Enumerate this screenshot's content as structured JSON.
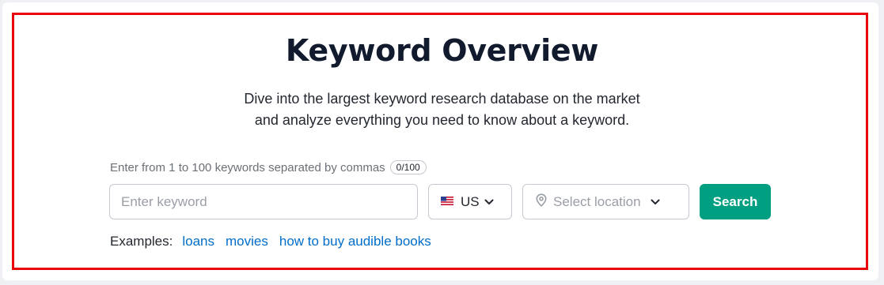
{
  "header": {
    "title": "Keyword Overview",
    "subtitle_line1": "Dive into the largest keyword research database on the market",
    "subtitle_line2": "and analyze everything you need to know about a keyword."
  },
  "form": {
    "hint": "Enter from 1 to 100 keywords separated by commas",
    "counter": "0/100",
    "keyword_placeholder": "Enter keyword",
    "keyword_value": "",
    "database": {
      "flag_icon": "us-flag-icon",
      "selected": "US"
    },
    "location": {
      "icon": "location-pin-icon",
      "placeholder": "Select location"
    },
    "search_label": "Search"
  },
  "examples": {
    "label": "Examples:",
    "items": [
      "loans",
      "movies",
      "how to buy audible books"
    ]
  },
  "colors": {
    "accent": "#009f81",
    "link": "#006dca",
    "highlight_border": "#e8000b",
    "title": "#121a2e"
  }
}
